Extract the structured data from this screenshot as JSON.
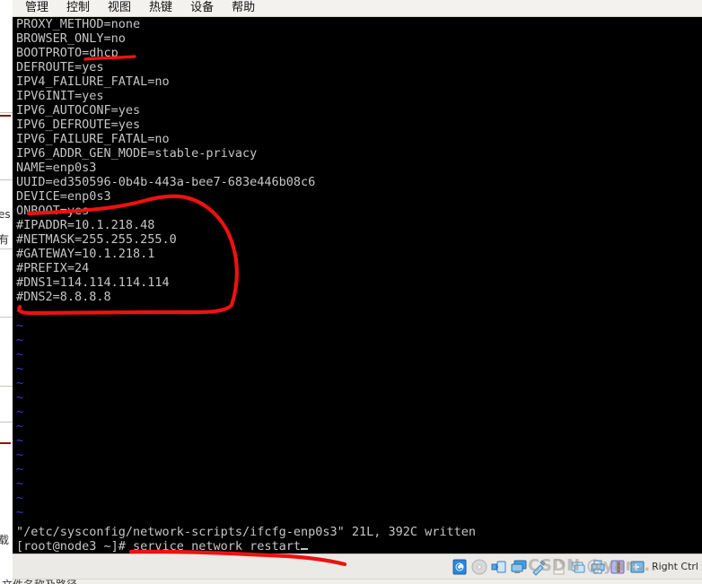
{
  "window": {
    "menubar": [
      {
        "label": "管理",
        "name": "menu-manage"
      },
      {
        "label": "控制",
        "name": "menu-control"
      },
      {
        "label": "视图",
        "name": "menu-view"
      },
      {
        "label": "热键",
        "name": "menu-hotkey"
      },
      {
        "label": "设备",
        "name": "menu-device"
      },
      {
        "label": "帮助",
        "name": "menu-help"
      }
    ]
  },
  "terminal": {
    "config_lines": [
      "PROXY_METHOD=none",
      "BROWSER_ONLY=no",
      "BOOTPROTO=dhcp",
      "DEFROUTE=yes",
      "IPV4_FAILURE_FATAL=no",
      "IPV6INIT=yes",
      "IPV6_AUTOCONF=yes",
      "IPV6_DEFROUTE=yes",
      "IPV6_FAILURE_FATAL=no",
      "IPV6_ADDR_GEN_MODE=stable-privacy",
      "NAME=enp0s3",
      "UUID=ed350596-0b4b-443a-bee7-683e446b08c6",
      "DEVICE=enp0s3",
      "ONBOOT=yes",
      "#IPADDR=10.1.218.48",
      "#NETMASK=255.255.255.0",
      "#GATEWAY=10.1.218.1",
      "#PREFIX=24",
      "#DNS1=114.114.114.114",
      "#DNS2=8.8.8.8"
    ],
    "empty_line_marker": "~",
    "empty_line_count": 15,
    "vim_status": "\"/etc/sysconfig/network-scripts/ifcfg-enp0s3\" 21L, 392C written",
    "prompt": "[root@node3 ~]# service network restart"
  },
  "statusbar": {
    "icons": [
      {
        "name": "hard-disk-icon",
        "label": "硬盘"
      },
      {
        "name": "cd-dvd-icon",
        "label": "CD/DVD"
      },
      {
        "name": "network-adapter-icon",
        "label": "网络适配器"
      },
      {
        "name": "display-icon",
        "label": "显示器"
      },
      {
        "name": "usb-icon",
        "label": "USB"
      },
      {
        "name": "document-icon",
        "label": "文档"
      },
      {
        "name": "shared-folder-icon",
        "label": "共享文件夹"
      },
      {
        "name": "printer-icon",
        "label": "打印机"
      },
      {
        "name": "sound-card-icon",
        "label": "声卡"
      },
      {
        "name": "input-capture-icon",
        "label": "输入"
      }
    ],
    "hint_text": "Right Ctrl"
  },
  "watermark": {
    "text": "CSDN @yan..."
  },
  "background": {
    "left_fragments": [
      "es",
      "有",
      "载"
    ]
  },
  "annotations": {
    "underline_dhcp": "红色下划线 dhcp",
    "circle_commented_block": "红色圈出注释行",
    "underline_command": "红色下划线 service network restart",
    "color": "#ee1111"
  }
}
